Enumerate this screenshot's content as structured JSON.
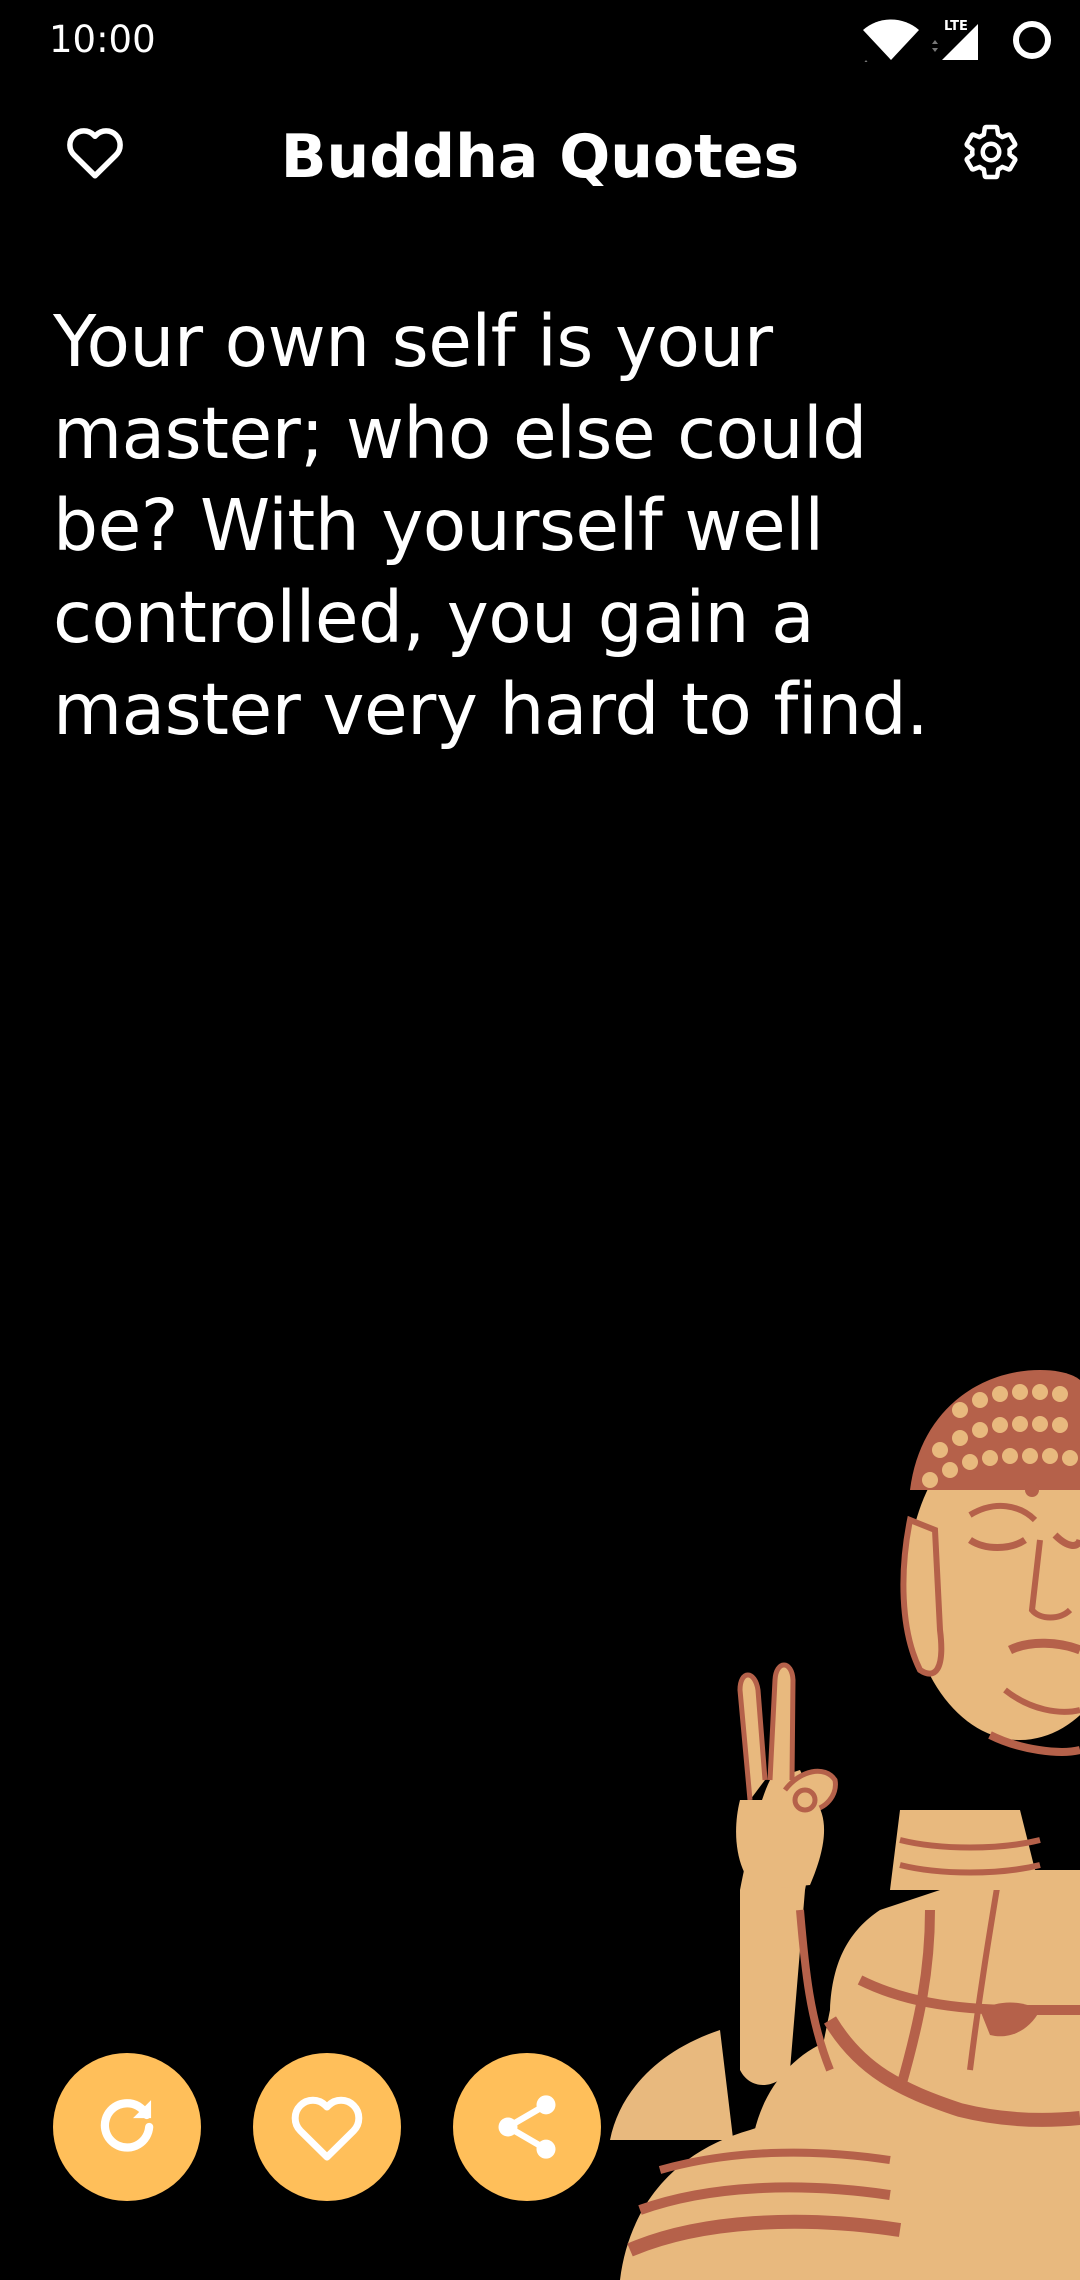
{
  "status_bar": {
    "time": "10:00",
    "network_label": "LTE",
    "icons": [
      "wifi-icon",
      "cell-signal-icon",
      "battery-ring-icon"
    ]
  },
  "header": {
    "title": "Buddha Quotes",
    "left_icon": "heart-outline-icon",
    "right_icon": "gear-icon"
  },
  "quote": {
    "text": "Your own self is your master; who else could be? With yourself well controlled, you gain a master very hard to find."
  },
  "actions": {
    "items": [
      "refresh-icon",
      "heart-icon",
      "share-icon"
    ]
  },
  "colors": {
    "background": "#000000",
    "accent": "#FFBF5A",
    "statue_light": "#E8B97E",
    "statue_shadow": "#B5614A",
    "text": "#FFFFFF"
  }
}
